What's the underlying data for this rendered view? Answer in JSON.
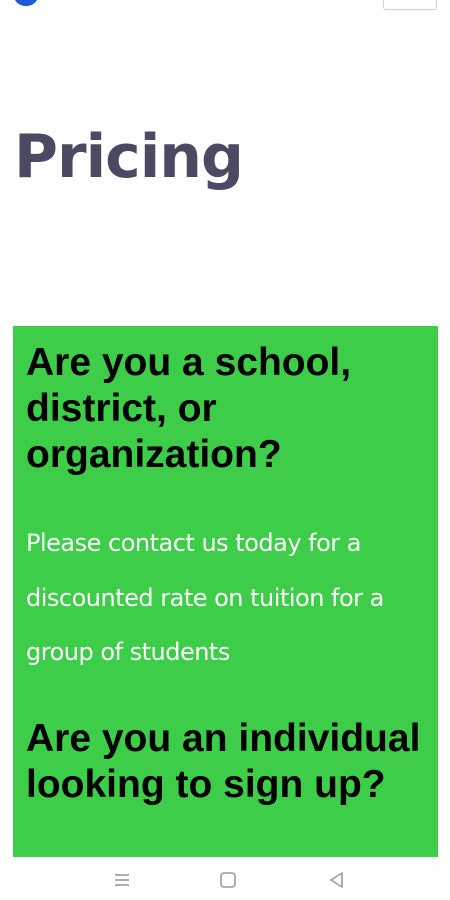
{
  "header": {
    "logo_icon": "logo-icon",
    "menu_icon": "menu-button",
    "brand_color": "#1f5bd8"
  },
  "main": {
    "title": "Pricing",
    "title_color": "#4a4a63"
  },
  "panel": {
    "background_color": "#3dcd48",
    "org_heading": "Are you a school, district, or organization?",
    "org_text": "Please contact us today for a discounted rate on tuition for a group of students",
    "individual_heading": "Are you an individual looking to sign up?"
  },
  "system_nav": {
    "menu_icon": "recents-icon",
    "home_icon": "home-icon",
    "back_icon": "back-icon"
  }
}
